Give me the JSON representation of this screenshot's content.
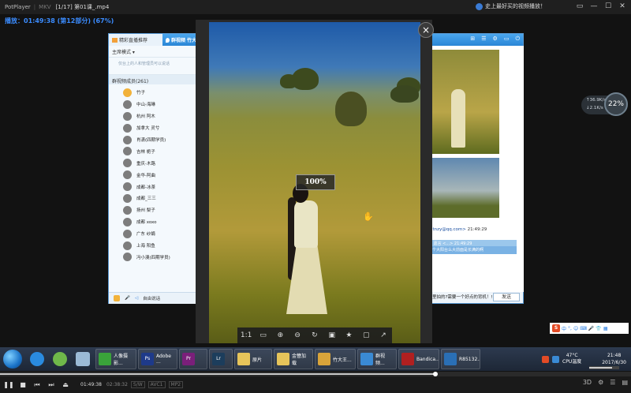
{
  "player": {
    "app_name": "PotPlayer",
    "mkv_tag": "MKV",
    "title": "[1/17] 第01课_.mp4",
    "ad_text": "史上最好买的视频播放！",
    "osd": "播放：01:49:38 (第12部分) (67%)",
    "current_time": "01:49:38",
    "duration": "02:38:32",
    "format_tags": [
      "S/W",
      "AVC1",
      "MP2"
    ],
    "progress_fraction": 0.69,
    "volume_fraction": 0.75
  },
  "qq": {
    "tab_live": "精彩直播推荐",
    "tab_group": "群视频 竹大王的...",
    "mode_label": "主席模式",
    "notice": "仅台上的人和管理员可以说话",
    "members_header": "群视频成员(261)",
    "members": [
      "竹子",
      "中山-海琳",
      "杭州 阿木",
      "加拿大 灵兮",
      "肖潇(四期学员)",
      "吉林 栀子",
      "重庆-木路",
      "金华-阿曲",
      "成都-冰茶",
      "成都_三三",
      "扬州 梨子",
      "成都 xoxo",
      "广东 纱娟",
      "上海 阳鱼",
      "冯小澳(四期学员)"
    ],
    "bottom_tool": "自由说话",
    "sender": "<shitnzy@qq.com>",
    "sender_time": "21:49:29",
    "msg1": "四川 嘉言 <...> 21:49:29",
    "msg2": "还是个大阳台么大前面是长满的啊",
    "input_text": "在哪里拍的?需要一个好点的背机！!",
    "send_label": "发送"
  },
  "viewer": {
    "zoom": "100%",
    "close": "×",
    "tools": [
      "1:1",
      "▭",
      "⊕",
      "⊖",
      "↻",
      "▣",
      "★",
      "▢",
      "↗"
    ]
  },
  "speed": {
    "up": "↑36.9K/s",
    "down": "↓2.1K/s",
    "percent": "22%"
  },
  "ime": {
    "logo": "S",
    "items": [
      "中",
      "°,",
      "☺",
      "⌨",
      "🎤",
      "👕",
      "▦"
    ]
  },
  "taskbar": {
    "items": [
      {
        "label": "人像摄影...",
        "color": "#3aa33a"
      },
      {
        "label": "Adobe ...",
        "color": "#1e3a8a"
      },
      {
        "label": "",
        "color": "#7a1f7a"
      },
      {
        "label": "",
        "color": "#1c3d5c"
      },
      {
        "label": "原片",
        "color": "#e6c45a"
      },
      {
        "label": "金簪加载",
        "color": "#e6c45a"
      },
      {
        "label": "竹大王...",
        "color": "#d9a43a"
      },
      {
        "label": "群视频...",
        "color": "#3a8ad4"
      },
      {
        "label": "Bandica...",
        "color": "#b02020"
      },
      {
        "label": "R85132...",
        "color": "#2a6fb5"
      }
    ],
    "app_short": [
      "Ps",
      "Pr",
      "Lr"
    ],
    "cpu_temp": "47°C",
    "cpu_label": "CPU温度",
    "time": "21:48",
    "date": "2017/6/30"
  },
  "colors": {
    "accent": "#2a86d6",
    "osd": "#3b8cff"
  }
}
